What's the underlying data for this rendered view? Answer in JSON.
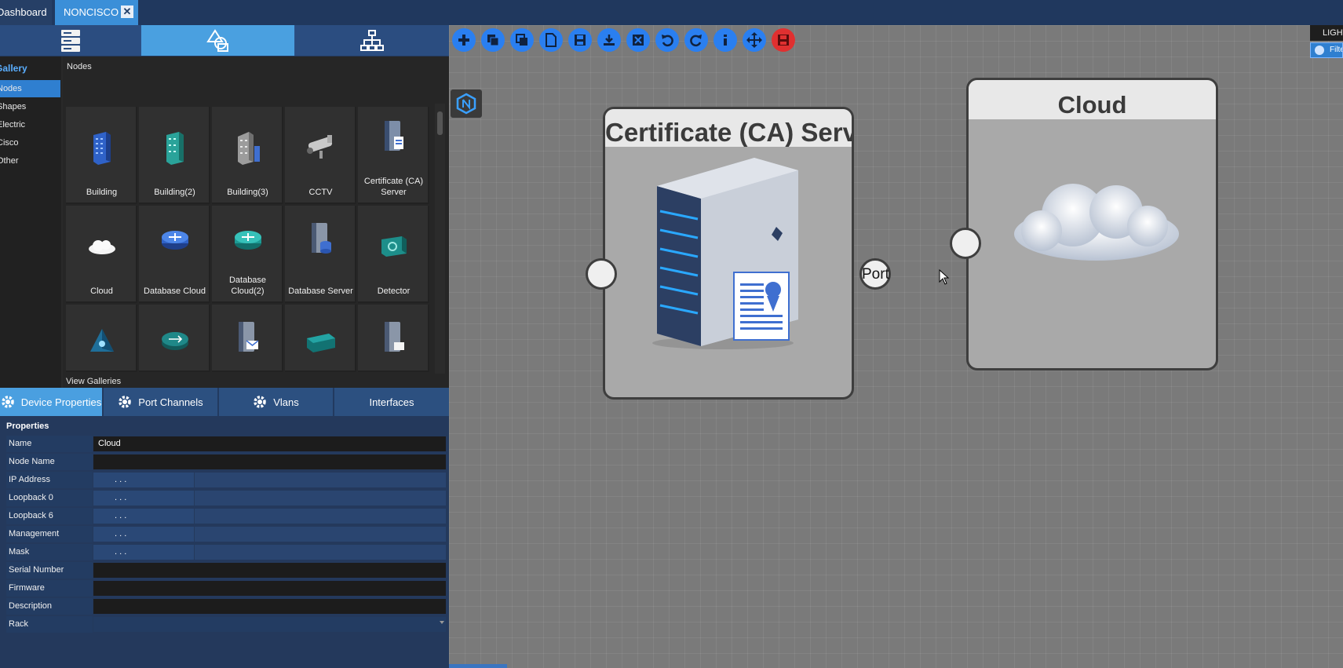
{
  "tabs": {
    "dashboard": "Dashboard",
    "document": "NONCISCO",
    "close": "✕"
  },
  "gallery": {
    "heading": "Gallery",
    "items": [
      "Nodes",
      "Shapes",
      "Electric",
      "Cisco",
      "Other"
    ],
    "selected": "Nodes",
    "nodes_title": "Nodes",
    "view_galleries": "View Galleries",
    "nodes": [
      {
        "label": "Building",
        "icon": "building-icon"
      },
      {
        "label": "Building(2)",
        "icon": "building-teal-icon"
      },
      {
        "label": "Building(3)",
        "icon": "building-gray-icon"
      },
      {
        "label": "CCTV",
        "icon": "cctv-camera-icon"
      },
      {
        "label": "Certificate (CA) Server",
        "icon": "certificate-server-icon"
      },
      {
        "label": "Cloud",
        "icon": "cloud-icon"
      },
      {
        "label": "Database Cloud",
        "icon": "router-blue-icon"
      },
      {
        "label": "Database Cloud(2)",
        "icon": "router-teal-icon"
      },
      {
        "label": "Database Server",
        "icon": "database-server-icon"
      },
      {
        "label": "Detector",
        "icon": "detector-icon"
      },
      {
        "label": "",
        "icon": "triangle-network-icon"
      },
      {
        "label": "",
        "icon": "switch-icon"
      },
      {
        "label": "",
        "icon": "mail-server-icon"
      },
      {
        "label": "",
        "icon": "device-teal-icon"
      },
      {
        "label": "",
        "icon": "file-server-icon"
      }
    ]
  },
  "panel_tabs": {
    "device_properties": "Device Properties",
    "port_channels": "Port Channels",
    "vlans": "Vlans",
    "interfaces": "Interfaces"
  },
  "properties": {
    "title": "Properties",
    "rows": [
      {
        "key": "Name",
        "value": "Cloud"
      },
      {
        "key": "Node Name",
        "value": ""
      },
      {
        "key": "IP Address",
        "value": ".    .    ."
      },
      {
        "key": "Loopback 0",
        "value": ".    .    ."
      },
      {
        "key": "Loopback 6",
        "value": ".    .    ."
      },
      {
        "key": "Management",
        "value": ".    .    ."
      },
      {
        "key": "Mask",
        "value": ".    .    ."
      },
      {
        "key": "Serial Number",
        "value": ""
      },
      {
        "key": "Firmware",
        "value": ""
      },
      {
        "key": "Description",
        "value": ""
      },
      {
        "key": "Rack",
        "value": ""
      }
    ]
  },
  "canvas": {
    "light_tab": "LIGHT",
    "filter": "Filter",
    "ca_node_title": "Certificate (CA) Server",
    "cloud_node_title": "Cloud",
    "port_label": "Port"
  },
  "colors": {
    "accent": "#4aa0e0",
    "toolbar_button": "#2a7ff0",
    "stop_button": "#e03030",
    "canvas": "#7a7a7a"
  }
}
